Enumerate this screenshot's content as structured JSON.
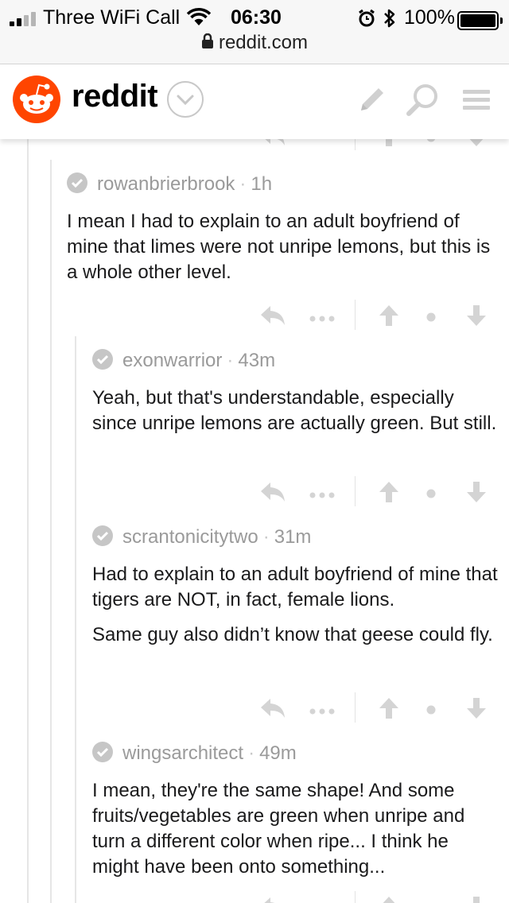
{
  "status": {
    "carrier": "Three WiFi Call",
    "time": "06:30",
    "battery": "100%",
    "battery_level": 1.0,
    "url": "reddit.com"
  },
  "header": {
    "logo_text": "reddit",
    "icons": [
      "snoo-logo-icon",
      "chevron-down-icon",
      "pencil-icon",
      "search-icon",
      "menu-icon"
    ],
    "brand_color": "#ff4500"
  },
  "comments": [
    {
      "author": "rowanbrierbrook",
      "time": "1h",
      "paragraphs": [
        "I mean I had to explain to an adult boyfriend of mine that limes were not unripe lemons, but this is a whole other level."
      ]
    },
    {
      "author": "exonwarrior",
      "time": "43m",
      "paragraphs": [
        "Yeah, but that's understandable, especially since unripe lemons are actually green. But still."
      ]
    },
    {
      "author": "scrantonicitytwo",
      "time": "31m",
      "paragraphs": [
        "Had to explain to an adult boyfriend of mine that tigers are NOT, in fact, female lions.",
        "Same guy also didn’t know that geese could fly."
      ]
    },
    {
      "author": "wingsarchitect",
      "time": "49m",
      "paragraphs": [
        "I mean, they're the same shape! And some fruits/vegetables are green when unripe and turn a different color when ripe... I think he might have been onto something..."
      ]
    }
  ]
}
